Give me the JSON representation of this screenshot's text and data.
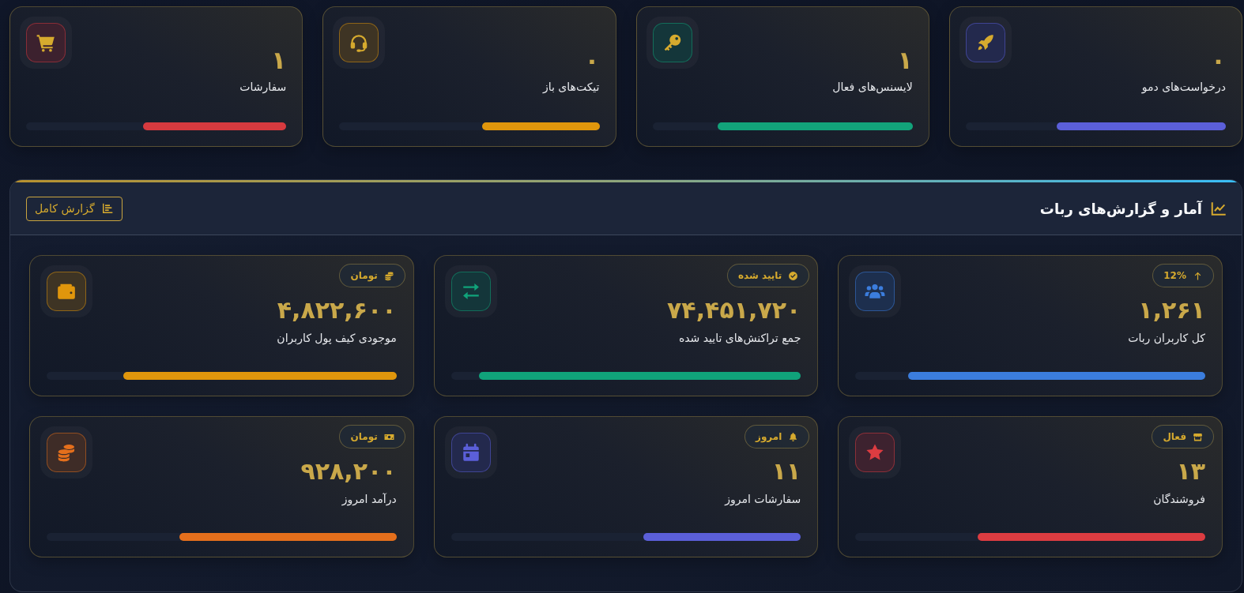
{
  "top_cards": [
    {
      "value": "۰",
      "label": "درخواست‌های دمو",
      "level": 0.65,
      "color": "#5b5fd9"
    },
    {
      "value": "۱",
      "label": "لایسنس‌های فعال",
      "level": 0.75,
      "color": "#12a37a"
    },
    {
      "value": "۰",
      "label": "تیکت‌های باز",
      "level": 0.45,
      "color": "#e0960c"
    },
    {
      "value": "۱",
      "label": "سفارشات",
      "level": 0.55,
      "color": "#d63a3f"
    }
  ],
  "report": {
    "title": "آمار و گزارش‌های ربات",
    "button": "گزارش کامل",
    "cards": [
      {
        "badge": "12%",
        "value": "۱,۲۶۱",
        "label": "کل کاربران ربات",
        "level": 0.85,
        "color": "#3b7ddd"
      },
      {
        "badge": "تایید شده",
        "value": "۷۴,۴۵۱,۷۲۰",
        "label": "جمع تراکنش‌های تایید شده",
        "level": 0.92,
        "color": "#10a37a"
      },
      {
        "badge": "تومان",
        "value": "۴,۸۲۲,۶۰۰",
        "label": "موجودی کیف پول کاربران",
        "level": 0.78,
        "color": "#e0960c"
      },
      {
        "badge": "فعال",
        "value": "۱۳",
        "label": "فروشندگان",
        "level": 0.65,
        "color": "#dc3c41"
      },
      {
        "badge": "امروز",
        "value": "۱۱",
        "label": "سفارشات امروز",
        "level": 0.45,
        "color": "#5b5fd9"
      },
      {
        "badge": "تومان",
        "value": "۹۲۸,۲۰۰",
        "label": "درآمد امروز",
        "level": 0.62,
        "color": "#e46f1c"
      }
    ]
  }
}
